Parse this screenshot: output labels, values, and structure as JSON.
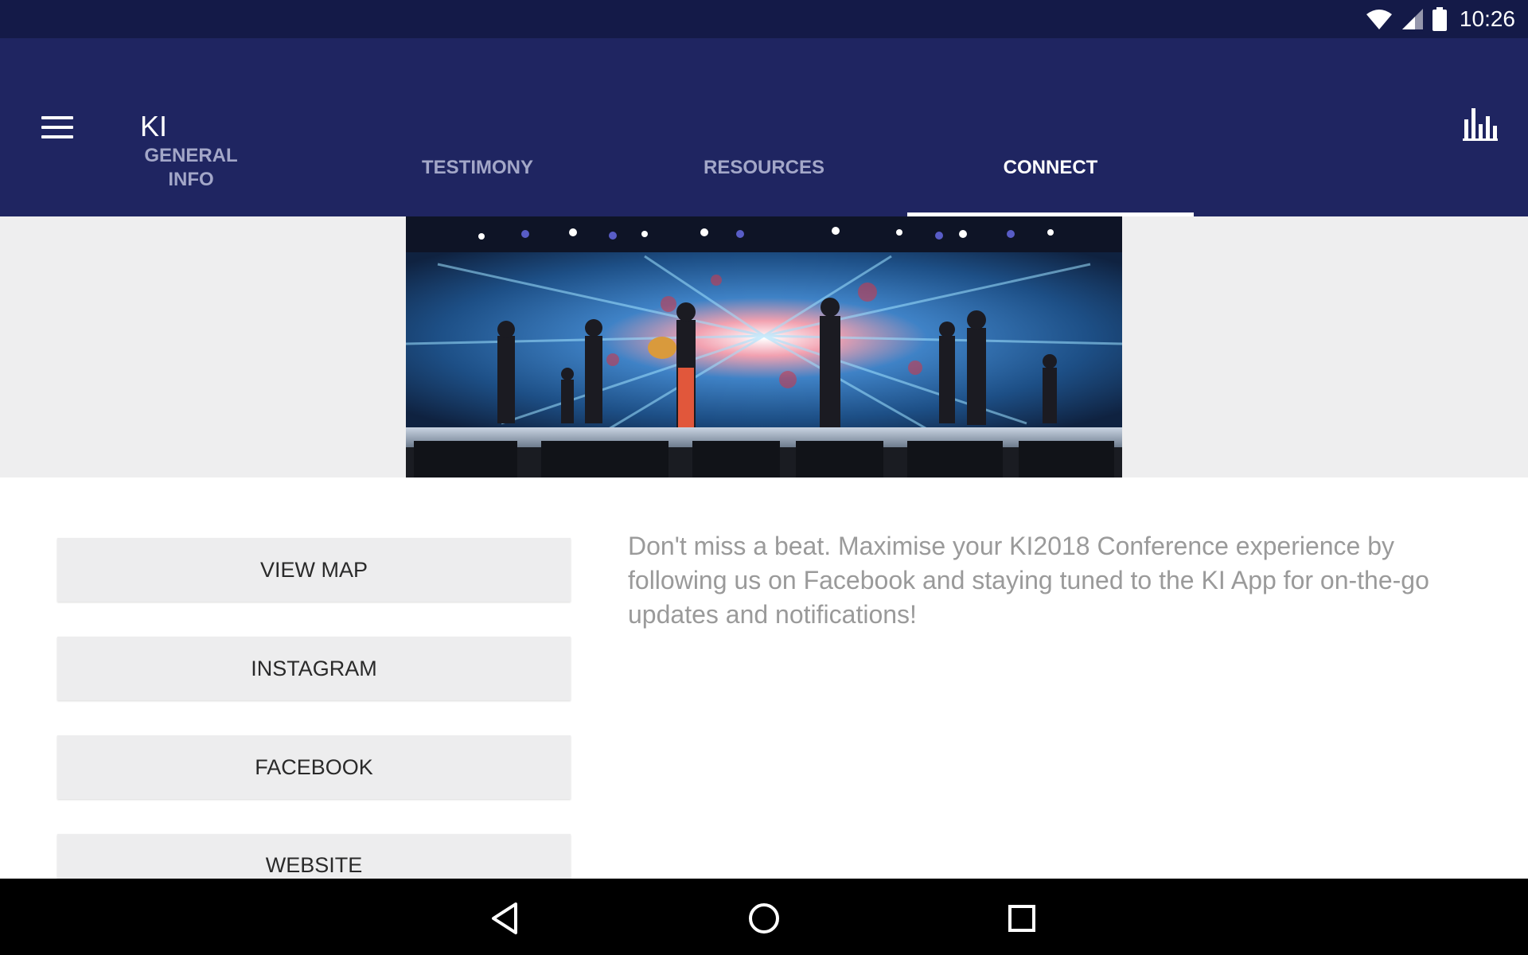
{
  "status_bar": {
    "time": "10:26",
    "icons": [
      "wifi-icon",
      "cell-signal-icon",
      "battery-icon"
    ]
  },
  "app_bar": {
    "title": "KI",
    "menu_icon": "hamburger-menu-icon",
    "action_icon": "bar-chart-icon"
  },
  "tabs": [
    {
      "label": "GENERAL\nINFO",
      "active": false
    },
    {
      "label": "TESTIMONY",
      "active": false
    },
    {
      "label": "RESOURCES",
      "active": false
    },
    {
      "label": "CONNECT",
      "active": true
    }
  ],
  "hero": {
    "image": "concert-stage-photo"
  },
  "buttons": {
    "view_map": "VIEW MAP",
    "instagram": "INSTAGRAM",
    "facebook": "FACEBOOK",
    "website": "WEBSITE"
  },
  "description": "Don't miss a beat. Maximise your KI2018 Conference experience by following us on Facebook and staying tuned to the KI App for on-the-go updates and notifications!",
  "nav_bar": {
    "icons": [
      "back-icon",
      "home-icon",
      "recents-icon"
    ]
  },
  "colors": {
    "status_bar": "#141a48",
    "app_bar": "#1f2561",
    "tab_inactive": "#a3a7c8",
    "button_bg": "#ededee",
    "text_muted": "#9a9a9a"
  }
}
